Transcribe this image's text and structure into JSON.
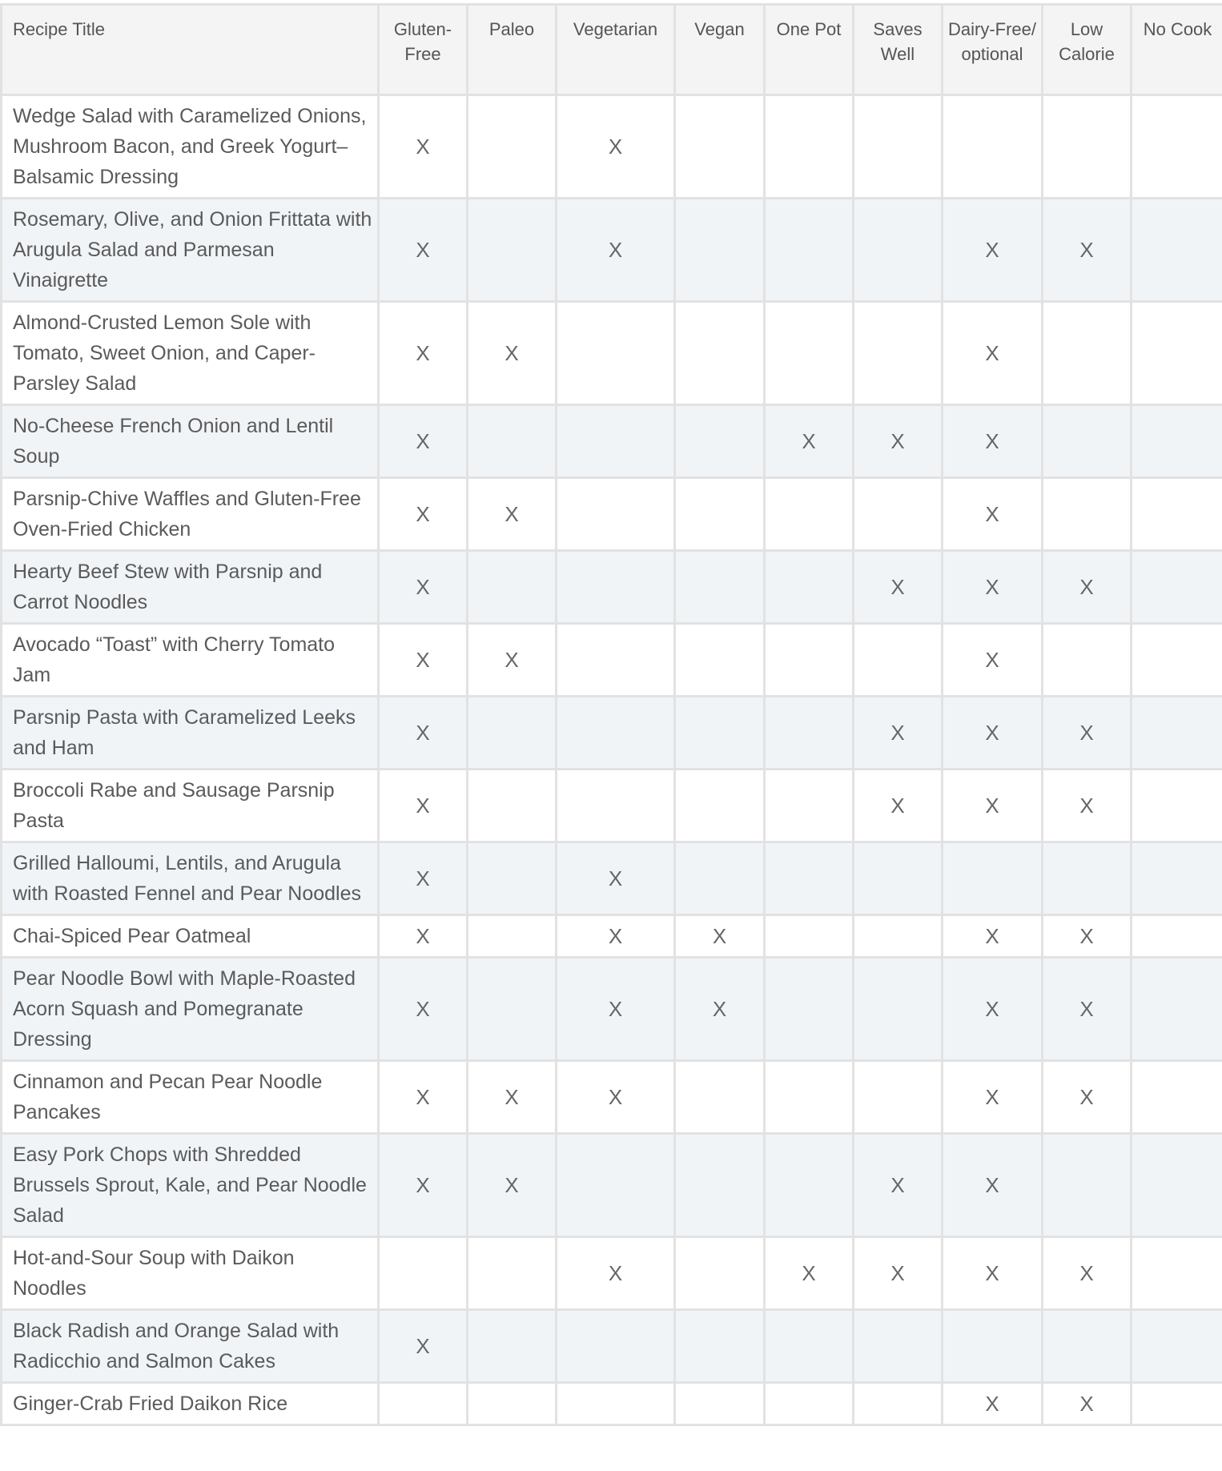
{
  "table": {
    "columns": [
      {
        "key": "title",
        "label": "Recipe Title"
      },
      {
        "key": "gluten_free",
        "label": "Gluten-Free"
      },
      {
        "key": "paleo",
        "label": "Paleo"
      },
      {
        "key": "vegetarian",
        "label": "Vegetarian"
      },
      {
        "key": "vegan",
        "label": "Vegan"
      },
      {
        "key": "one_pot",
        "label": "One Pot"
      },
      {
        "key": "saves_well",
        "label": "Saves Well"
      },
      {
        "key": "dairy_free",
        "label": "Dairy-Free/ optional"
      },
      {
        "key": "low_calorie",
        "label": "Low Calorie"
      },
      {
        "key": "no_cook",
        "label": "No Cook"
      }
    ],
    "mark_symbol": "X",
    "rows": [
      {
        "title": "Wedge Salad with Caramelized Onions, Mushroom Bacon, and Greek Yogurt–Balsamic Dressing",
        "marks": [
          "X",
          "",
          "X",
          "",
          "",
          "",
          "",
          "",
          ""
        ]
      },
      {
        "title": "Rosemary, Olive, and Onion Frittata with Arugula Salad and Parmesan Vinaigrette",
        "marks": [
          "X",
          "",
          "X",
          "",
          "",
          "",
          "X",
          "X",
          ""
        ]
      },
      {
        "title": "Almond-Crusted Lemon Sole with Tomato, Sweet Onion, and Caper-Parsley Salad",
        "marks": [
          "X",
          "X",
          "",
          "",
          "",
          "",
          "X",
          "",
          ""
        ]
      },
      {
        "title": "No-Cheese French Onion and Lentil Soup",
        "marks": [
          "X",
          "",
          "",
          "",
          "X",
          "X",
          "X",
          "",
          ""
        ]
      },
      {
        "title": "Parsnip-Chive Waffles and Gluten-Free Oven-Fried Chicken",
        "marks": [
          "X",
          "X",
          "",
          "",
          "",
          "",
          "X",
          "",
          ""
        ]
      },
      {
        "title": "Hearty Beef Stew with Parsnip and Carrot Noodles",
        "marks": [
          "X",
          "",
          "",
          "",
          "",
          "X",
          "X",
          "X",
          ""
        ]
      },
      {
        "title": "Avocado “Toast” with Cherry Tomato Jam",
        "marks": [
          "X",
          "X",
          "",
          "",
          "",
          "",
          "X",
          "",
          ""
        ]
      },
      {
        "title": "Parsnip Pasta with Caramelized Leeks and Ham",
        "marks": [
          "X",
          "",
          "",
          "",
          "",
          "X",
          "X",
          "X",
          ""
        ]
      },
      {
        "title": "Broccoli Rabe and Sausage Parsnip Pasta",
        "marks": [
          "X",
          "",
          "",
          "",
          "",
          "X",
          "X",
          "X",
          ""
        ]
      },
      {
        "title": "Grilled Halloumi, Lentils, and Arugula with Roasted Fennel and Pear Noodles",
        "marks": [
          "X",
          "",
          "X",
          "",
          "",
          "",
          "",
          "",
          ""
        ]
      },
      {
        "title": "Chai-Spiced Pear Oatmeal",
        "marks": [
          "X",
          "",
          "X",
          "X",
          "",
          "",
          "X",
          "X",
          ""
        ]
      },
      {
        "title": "Pear Noodle Bowl with Maple-Roasted Acorn Squash and Pomegranate Dressing",
        "marks": [
          "X",
          "",
          "X",
          "X",
          "",
          "",
          "X",
          "X",
          ""
        ]
      },
      {
        "title": "Cinnamon and Pecan Pear Noodle Pancakes",
        "marks": [
          "X",
          "X",
          "X",
          "",
          "",
          "",
          "X",
          "X",
          ""
        ]
      },
      {
        "title": "Easy Pork Chops with Shredded Brussels Sprout, Kale, and Pear Noodle Salad",
        "marks": [
          "X",
          "X",
          "",
          "",
          "",
          "X",
          "X",
          "",
          ""
        ]
      },
      {
        "title": "Hot-and-Sour Soup with Daikon Noodles",
        "marks": [
          "",
          "",
          "X",
          "",
          "X",
          "X",
          "X",
          "X",
          ""
        ]
      },
      {
        "title": "Black Radish and Orange Salad with Radicchio and Salmon Cakes",
        "marks": [
          "X",
          "",
          "",
          "",
          "",
          "",
          "",
          "",
          ""
        ]
      },
      {
        "title": "Ginger-Crab Fried Daikon Rice",
        "marks": [
          "",
          "",
          "",
          "",
          "",
          "",
          "X",
          "X",
          ""
        ]
      }
    ]
  },
  "colors": {
    "header_bg": "#f4f4f4",
    "row_alt_bg": "#f1f4f7",
    "border": "#e2e2e2",
    "text": "#5a5a5a"
  }
}
